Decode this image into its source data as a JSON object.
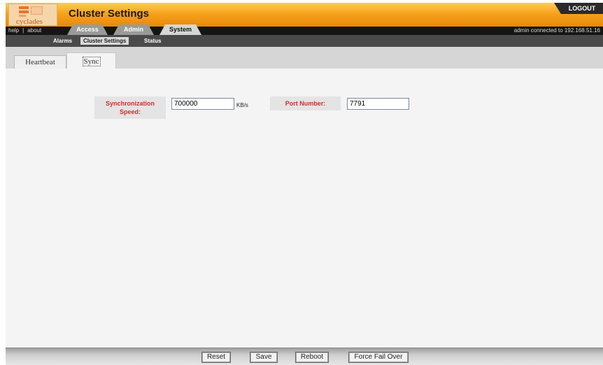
{
  "header": {
    "logo_text": "cyclades",
    "title": "Cluster Settings",
    "logout_label": "LOGOUT"
  },
  "nav": {
    "links": [
      "help",
      "about"
    ],
    "tabs": [
      {
        "label": "Access",
        "active": false
      },
      {
        "label": "Admin",
        "active": false
      },
      {
        "label": "System",
        "active": true
      }
    ],
    "connection_status": "admin connected to 192.168.51.16"
  },
  "subnav": {
    "items": [
      {
        "label": "Alarms",
        "active": false
      },
      {
        "label": "Cluster Settings",
        "active": true
      },
      {
        "label": "Status",
        "active": false
      }
    ]
  },
  "subtabs": [
    {
      "label": "Heartbeat",
      "active": false
    },
    {
      "label": "Sync",
      "active": true
    }
  ],
  "form": {
    "sync_speed_label": "Synchronization Speed:",
    "sync_speed_value": "700000",
    "sync_speed_unit": "KB/s",
    "port_label": "Port Number:",
    "port_value": "7791"
  },
  "footer": {
    "buttons": [
      "Reset",
      "Save",
      "Reboot",
      "Force Fail Over"
    ]
  }
}
